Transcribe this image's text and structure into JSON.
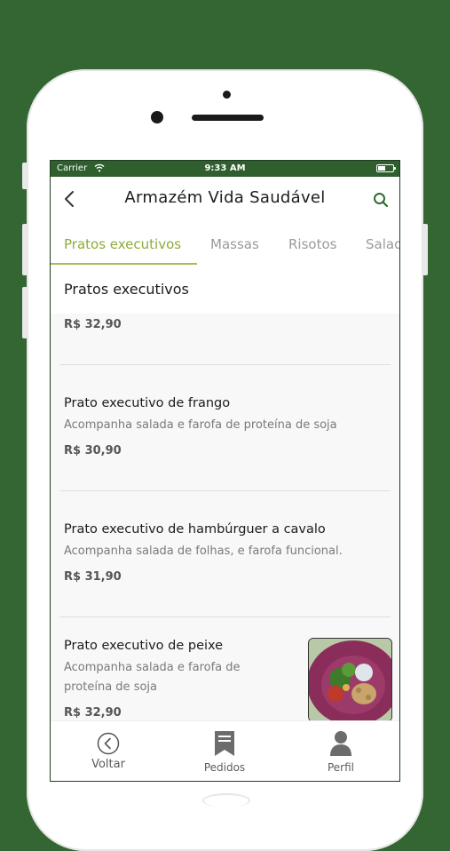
{
  "status": {
    "carrier": "Carrier",
    "time": "9:33 AM"
  },
  "header": {
    "title": "Armazém Vida Saudável"
  },
  "tabs": [
    {
      "label": "Pratos executivos",
      "active": true
    },
    {
      "label": "Massas"
    },
    {
      "label": "Risotos"
    },
    {
      "label": "Salad"
    }
  ],
  "section": {
    "title": "Pratos executivos"
  },
  "items": [
    {
      "price": "R$ 32,90"
    },
    {
      "title": "Prato executivo de frango",
      "desc": "Acompanha salada e farofa de proteína de soja",
      "price": "R$ 30,90"
    },
    {
      "title": "Prato executivo de hambúrguer a cavalo",
      "desc": "Acompanha salada de folhas, e farofa funcional.",
      "price": "R$ 31,90"
    },
    {
      "title": "Prato executivo de peixe",
      "desc_line1": "Acompanha salada e farofa de",
      "desc_line2": "proteína de soja",
      "price": "R$ 32,90"
    }
  ],
  "tabbar": [
    {
      "label": "Voltar",
      "icon": "back-circle-icon"
    },
    {
      "label": "Pedidos",
      "icon": "bookmark-icon"
    },
    {
      "label": "Perfil",
      "icon": "user-icon"
    }
  ],
  "colors": {
    "background": "#336633",
    "accent": "#8cab3a",
    "status_bar": "#2f5e2f"
  }
}
